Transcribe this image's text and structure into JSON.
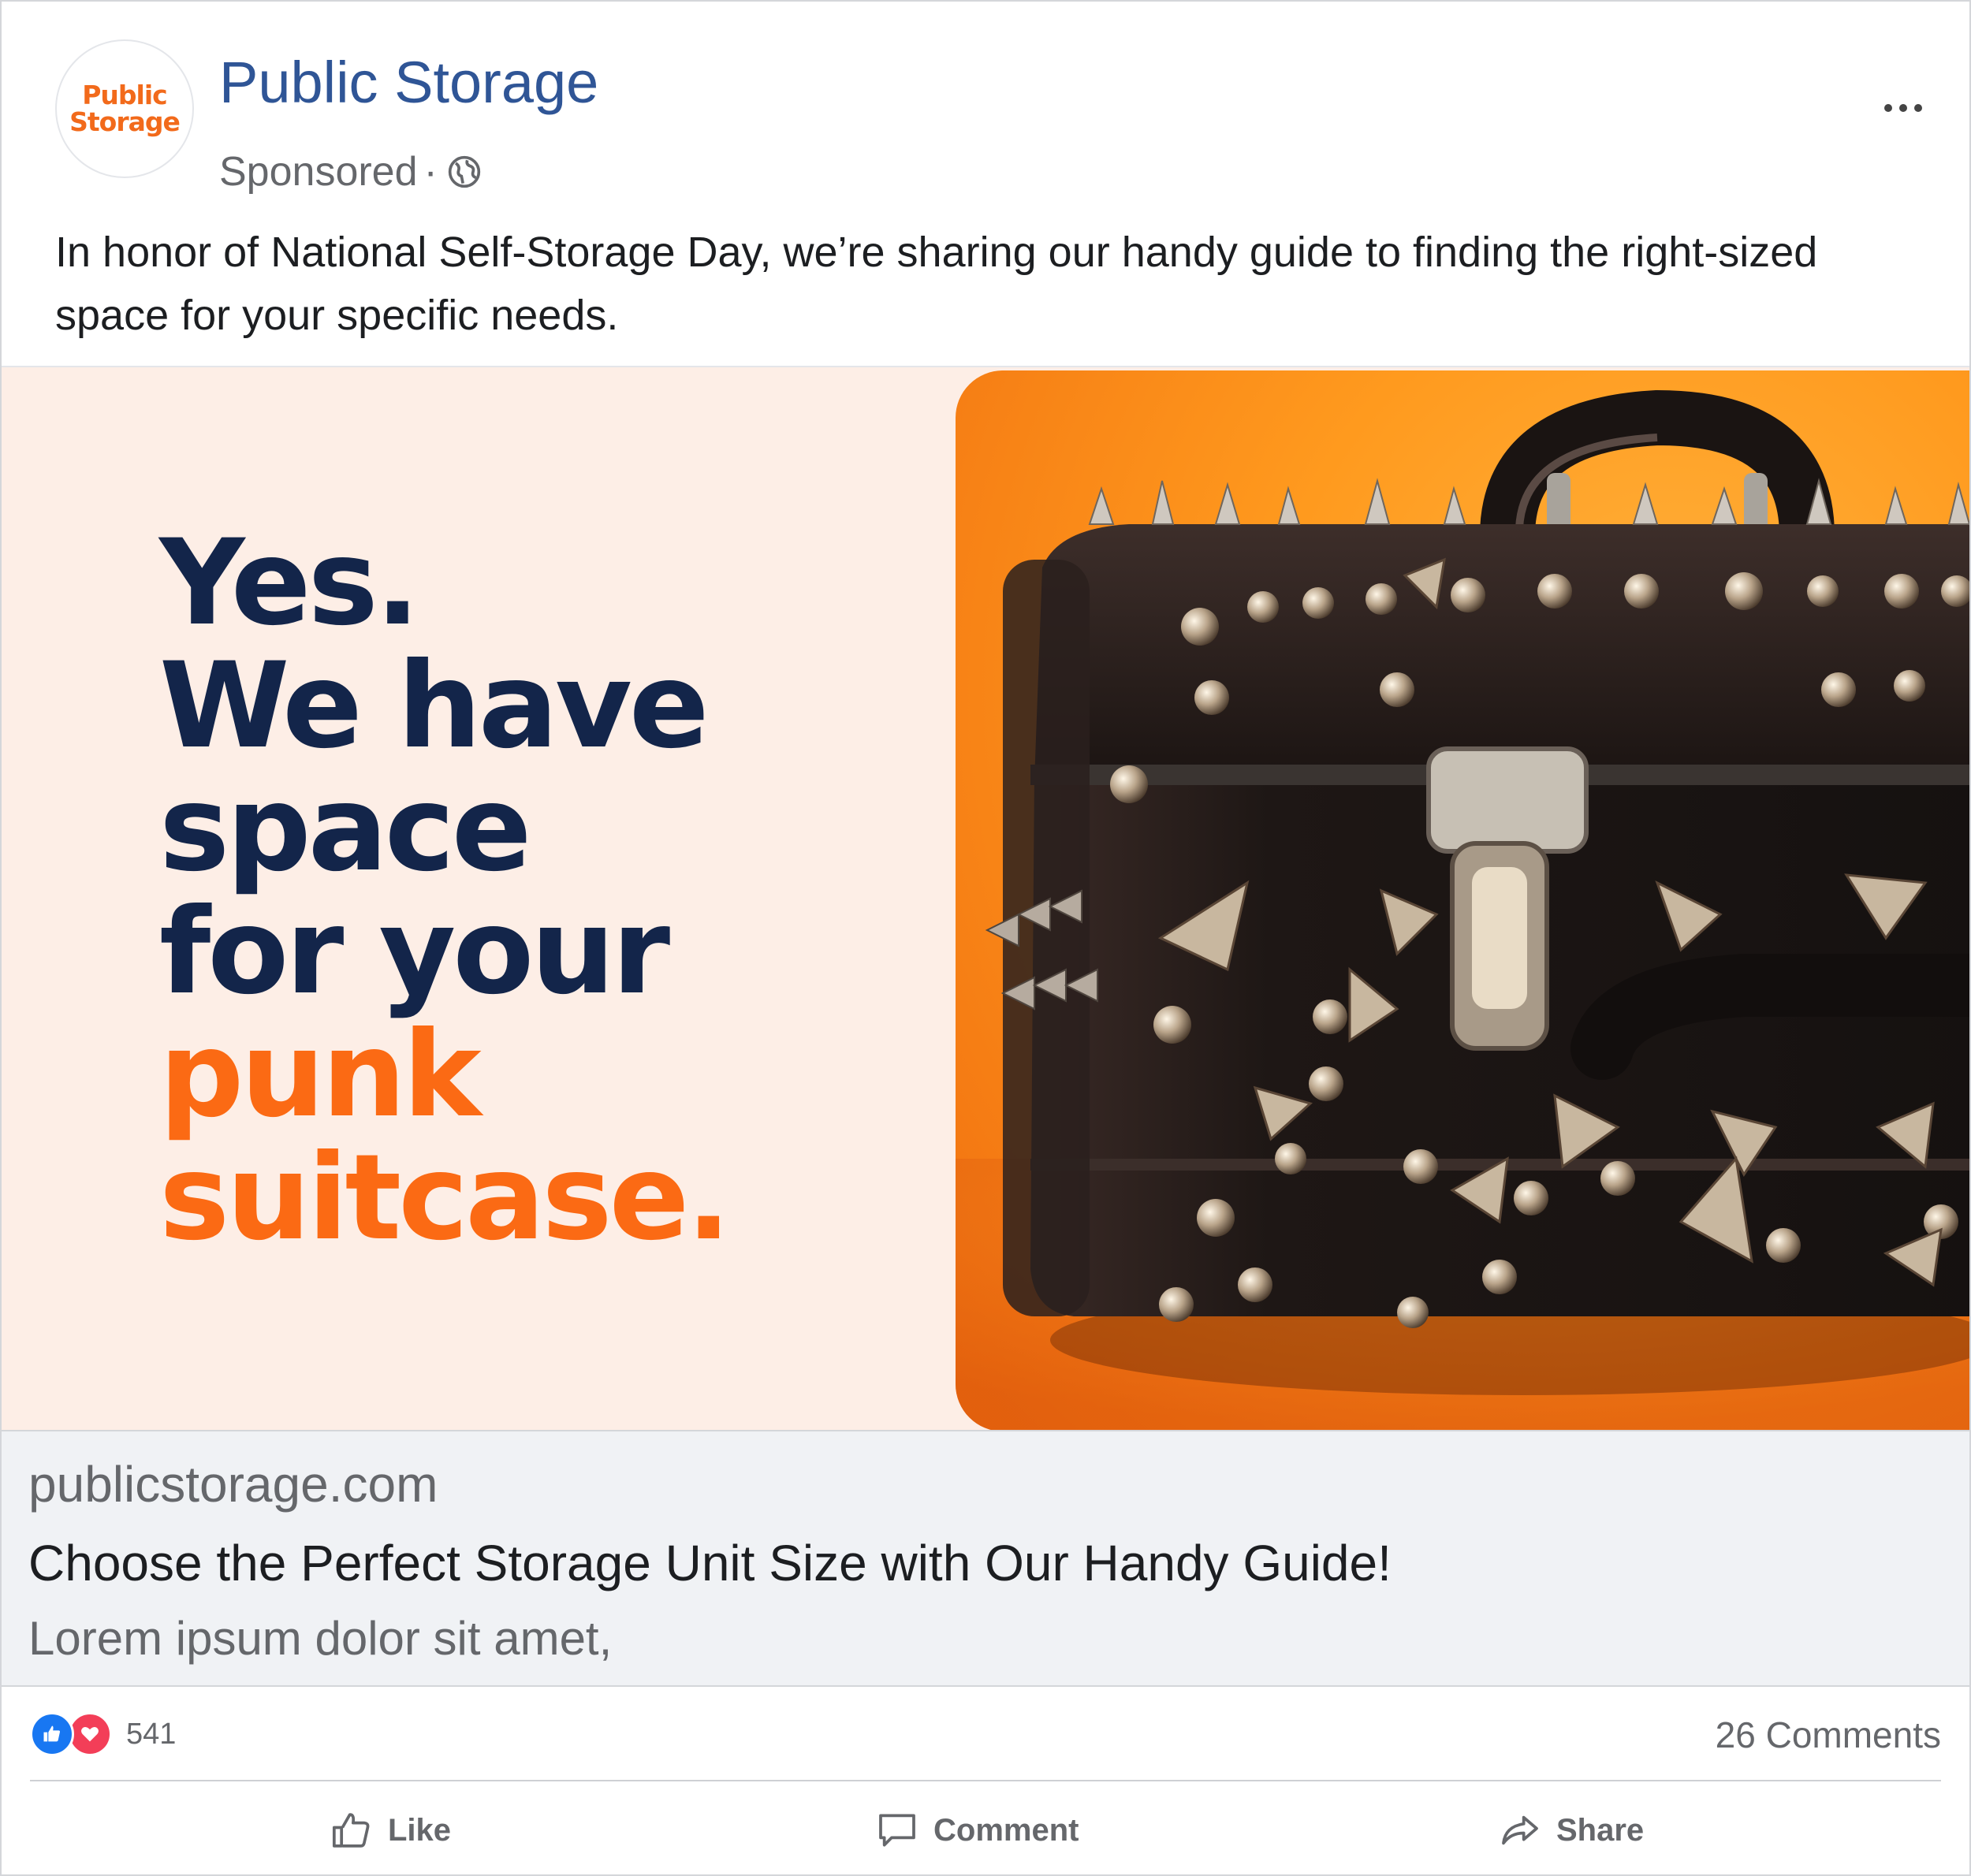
{
  "post": {
    "page_name": "Public Storage",
    "avatar_logo": [
      "Public",
      "Storage"
    ],
    "sponsored_label": "Sponsored",
    "separator": "·",
    "caption": "In honor of National Self-Storage Day, we’re sharing our handy guide to finding the right-sized space for your specific needs.",
    "icons": {
      "audience": "globe-icon",
      "menu": "more-options-icon"
    }
  },
  "creative": {
    "headline_navy": [
      "Yes.",
      "We have",
      "space",
      "for your"
    ],
    "headline_orange": [
      "punk",
      "suitcase."
    ],
    "colors": {
      "navy": "#13254a",
      "orange": "#fb6a14",
      "background": "#fdeee6"
    },
    "image_subject": "studded black punk suitcase on orange background"
  },
  "link_preview": {
    "domain": "publicstorage.com",
    "title": "Choose the Perfect Storage Unit Size with Our Handy Guide!",
    "description": "Lorem ipsum dolor sit amet,"
  },
  "engagement": {
    "reaction_count": "541",
    "comments": "26 Comments"
  },
  "actions": {
    "like": "Like",
    "comment": "Comment",
    "share": "Share"
  }
}
